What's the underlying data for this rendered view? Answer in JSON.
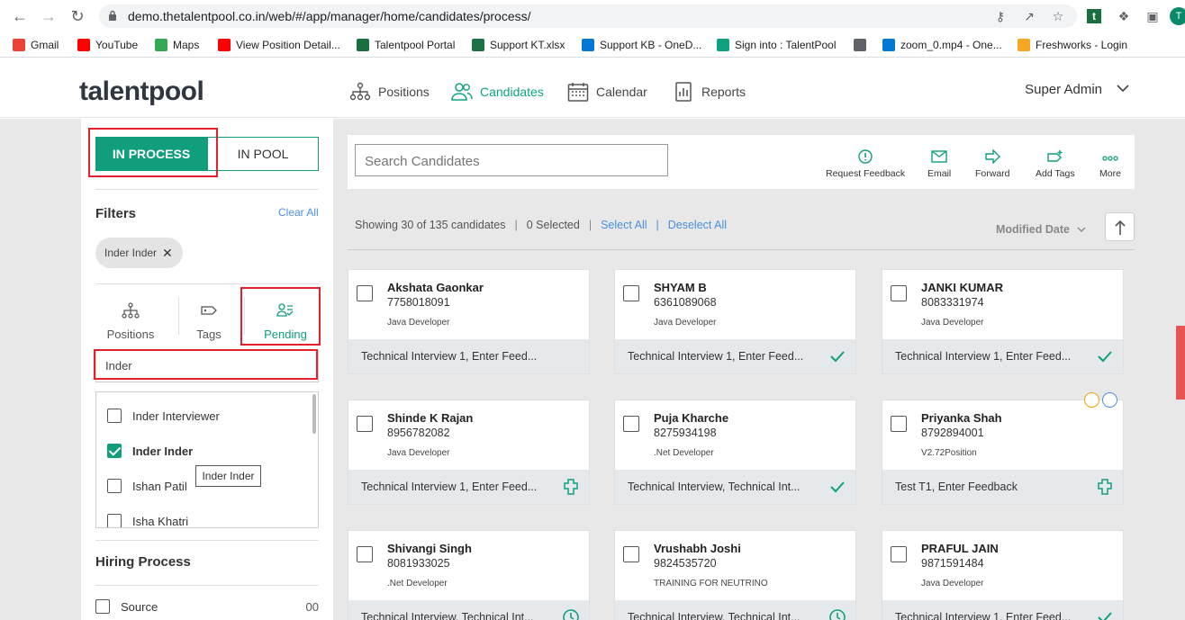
{
  "browser": {
    "url": "demo.thetalentpool.co.in/web/#/app/manager/home/candidates/process/",
    "profile_initial": "T",
    "bookmarks": [
      {
        "label": "Gmail",
        "color": "#ea4335"
      },
      {
        "label": "YouTube",
        "color": "#ff0000"
      },
      {
        "label": "Maps",
        "color": "#34a853"
      },
      {
        "label": "View Position Detail...",
        "color": "#ff0000"
      },
      {
        "label": "Talentpool Portal",
        "color": "#1b6e3f"
      },
      {
        "label": "Support KT.xlsx",
        "color": "#1e7145"
      },
      {
        "label": "Support KB - OneD...",
        "color": "#0078d4"
      },
      {
        "label": "Sign into : TalentPool",
        "color": "#0ea27f"
      },
      {
        "label": "",
        "color": "#5f6368"
      },
      {
        "label": "zoom_0.mp4 - One...",
        "color": "#0078d4"
      },
      {
        "label": "Freshworks - Login",
        "color": "#f5a623"
      }
    ]
  },
  "header": {
    "logo": "talentpool",
    "nav": [
      {
        "label": "Positions",
        "icon": "positions-icon",
        "active": false
      },
      {
        "label": "Candidates",
        "icon": "candidates-icon",
        "active": true
      },
      {
        "label": "Calendar",
        "icon": "calendar-icon",
        "active": false
      },
      {
        "label": "Reports",
        "icon": "reports-icon",
        "active": false
      }
    ],
    "user": "Super Admin"
  },
  "sidebar": {
    "tab_in_process": "IN PROCESS",
    "tab_in_pool": "IN POOL",
    "filters_title": "Filters",
    "clear_all": "Clear All",
    "chip_label": "Inder Inder",
    "filter_tabs": [
      {
        "label": "Positions"
      },
      {
        "label": "Tags"
      },
      {
        "label": "Pending"
      }
    ],
    "search_value": "Inder",
    "list": [
      {
        "label": "Inder Interviewer",
        "checked": false
      },
      {
        "label": "Inder Inder",
        "checked": true
      },
      {
        "label": "Ishan Patil",
        "checked": false
      },
      {
        "label": "Isha Khatri",
        "checked": false
      }
    ],
    "tooltip": "Inder Inder",
    "hiring_title": "Hiring Process",
    "source_label": "Source",
    "source_count": "00"
  },
  "toolbar": {
    "search_placeholder": "Search Candidates",
    "actions": [
      {
        "label": "Request Feedback",
        "icon": "alert-circle-icon"
      },
      {
        "label": "Email",
        "icon": "mail-icon"
      },
      {
        "label": "Forward",
        "icon": "forward-arrow-icon"
      },
      {
        "label": "Add Tags",
        "icon": "tag-plus-icon"
      },
      {
        "label": "More",
        "icon": "more-dots-icon"
      }
    ]
  },
  "summary": {
    "showing": "Showing 30 of 135 candidates",
    "selected": "0 Selected",
    "select_all": "Select All",
    "deselect_all": "Deselect All",
    "sort_label": "Modified Date"
  },
  "colors": {
    "accent": "#109e7d",
    "link": "#4a90e2",
    "highlight_border": "#e5202e"
  },
  "cards": [
    {
      "name": "Akshata Gaonkar",
      "phone": "7758018091",
      "role": "Java Developer",
      "stage": "Technical Interview 1, Enter Feed...",
      "status": "none"
    },
    {
      "name": "SHYAM B",
      "phone": "6361089068",
      "role": "Java Developer",
      "stage": "Technical Interview 1, Enter Feed...",
      "status": "check"
    },
    {
      "name": "JANKI KUMAR",
      "phone": "8083331974",
      "role": "Java Developer",
      "stage": "Technical Interview 1, Enter Feed...",
      "status": "check"
    },
    {
      "name": "Shinde K Rajan",
      "phone": "8956782082",
      "role": "Java Developer",
      "stage": "Technical Interview 1, Enter Feed...",
      "status": "puzzle"
    },
    {
      "name": "Puja Kharche",
      "phone": "8275934198",
      "role": ".Net Developer",
      "stage": "Technical Interview, Technical Int...",
      "status": "check"
    },
    {
      "name": "Priyanka Shah",
      "phone": "8792894001",
      "role": "V2.72Position",
      "stage": "Test T1, Enter Feedback",
      "status": "puzzle",
      "badges": true
    },
    {
      "name": "Shivangi Singh",
      "phone": "8081933025",
      "role": ".Net Developer",
      "stage": "Technical Interview, Technical Int...",
      "status": "clock"
    },
    {
      "name": "Vrushabh Joshi",
      "phone": "9824535720",
      "role": "TRAINING FOR NEUTRINO",
      "stage": "Technical Interview, Technical Int...",
      "status": "clock"
    },
    {
      "name": "PRAFUL JAIN",
      "phone": "9871591484",
      "role": "Java Developer",
      "stage": "Technical Interview 1, Enter Feed...",
      "status": "check"
    }
  ]
}
